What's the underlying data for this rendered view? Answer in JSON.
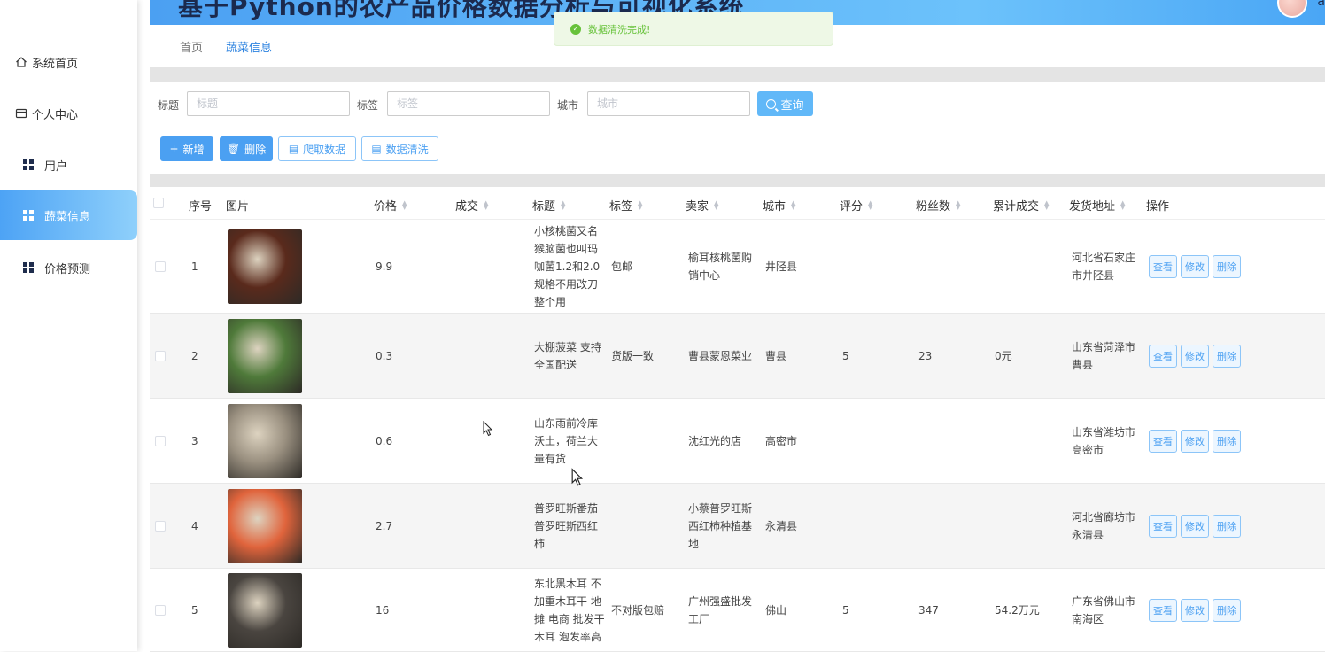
{
  "header": {
    "title": "基于Python的农产品价格数据分析与可视化系统",
    "avatar_name": "a"
  },
  "sidebar": {
    "items": [
      {
        "label": "系统首页",
        "icon": "home-icon"
      },
      {
        "label": "个人中心",
        "icon": "card-icon"
      },
      {
        "label": "用户",
        "icon": "grid-icon"
      },
      {
        "label": "蔬菜信息",
        "icon": "grid-icon",
        "active": true
      },
      {
        "label": "价格预测",
        "icon": "grid-icon"
      }
    ]
  },
  "breadcrumb": {
    "home": "首页",
    "current": "蔬菜信息"
  },
  "toast": {
    "message": "数据清洗完成!"
  },
  "search": {
    "title_label": "标题",
    "title_placeholder": "标题",
    "tag_label": "标签",
    "tag_placeholder": "标签",
    "city_label": "城市",
    "city_placeholder": "城市",
    "query_label": "查询"
  },
  "toolbar": {
    "add": "新增",
    "delete": "删除",
    "crawl": "爬取数据",
    "clean": "数据清洗"
  },
  "columns": [
    "序号",
    "图片",
    "价格",
    "成交",
    "标题",
    "标签",
    "卖家",
    "城市",
    "评分",
    "粉丝数",
    "累计成交",
    "发货地址",
    "操作"
  ],
  "row_actions": {
    "view": "查看",
    "edit": "修改",
    "delete": "删除"
  },
  "rows": [
    {
      "index": "1",
      "price": "9.9",
      "deals": "",
      "title": "小核桃菌又名猴脑菌也叫玛咖菌1.2和2.0规格不用改刀整个用",
      "tag": "包邮",
      "seller": "榆耳核桃菌购销中心",
      "city": "井陉县",
      "rating": "",
      "fans": "",
      "total": "",
      "address": "河北省石家庄市井陉县",
      "thumb_color": "#5a2a1c"
    },
    {
      "index": "2",
      "price": "0.3",
      "deals": "",
      "title": "大棚菠菜 支持全国配送",
      "tag": "货版一致",
      "seller": "曹县蒙恩菜业",
      "city": "曹县",
      "rating": "5",
      "fans": "23",
      "total": "0元",
      "address": "山东省菏泽市曹县",
      "thumb_color": "#4f7a3a"
    },
    {
      "index": "3",
      "price": "0.6",
      "deals": "",
      "title": "山东雨前冷库沃土，荷兰大量有货",
      "tag": "",
      "seller": "沈红光的店",
      "city": "高密市",
      "rating": "",
      "fans": "",
      "total": "",
      "address": "山东省潍坊市高密市",
      "thumb_color": "#9a9080"
    },
    {
      "index": "4",
      "price": "2.7",
      "deals": "",
      "title": "普罗旺斯番茄 普罗旺斯西红柿",
      "tag": "",
      "seller": "小蔡普罗旺斯西红柿种植基地",
      "city": "永清县",
      "rating": "",
      "fans": "",
      "total": "",
      "address": "河北省廊坊市永清县",
      "thumb_color": "#e0643c"
    },
    {
      "index": "5",
      "price": "16",
      "deals": "",
      "title": "东北黑木耳 不加重木耳干 地摊 电商 批发干木耳 泡发率高",
      "tag": "不对版包赔",
      "seller": "广州强盛批发工厂",
      "city": "佛山",
      "rating": "5",
      "fans": "347",
      "total": "54.2万元",
      "address": "广东省佛山市南海区",
      "thumb_color": "#4a4540"
    }
  ]
}
